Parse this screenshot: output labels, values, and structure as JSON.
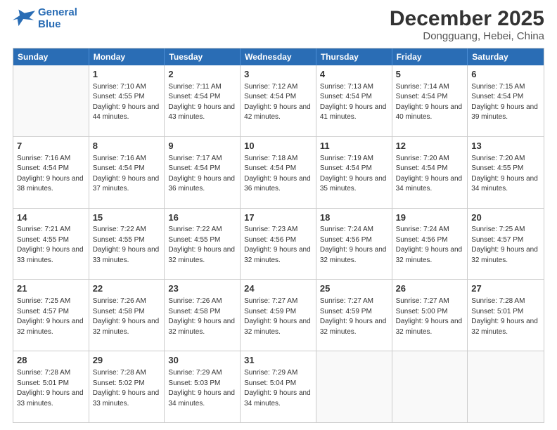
{
  "logo": {
    "line1": "General",
    "line2": "Blue"
  },
  "title": "December 2025",
  "location": "Dongguang, Hebei, China",
  "weekdays": [
    "Sunday",
    "Monday",
    "Tuesday",
    "Wednesday",
    "Thursday",
    "Friday",
    "Saturday"
  ],
  "weeks": [
    [
      {
        "day": "",
        "sunrise": "",
        "sunset": "",
        "daylight": ""
      },
      {
        "day": "1",
        "sunrise": "Sunrise: 7:10 AM",
        "sunset": "Sunset: 4:55 PM",
        "daylight": "Daylight: 9 hours and 44 minutes."
      },
      {
        "day": "2",
        "sunrise": "Sunrise: 7:11 AM",
        "sunset": "Sunset: 4:54 PM",
        "daylight": "Daylight: 9 hours and 43 minutes."
      },
      {
        "day": "3",
        "sunrise": "Sunrise: 7:12 AM",
        "sunset": "Sunset: 4:54 PM",
        "daylight": "Daylight: 9 hours and 42 minutes."
      },
      {
        "day": "4",
        "sunrise": "Sunrise: 7:13 AM",
        "sunset": "Sunset: 4:54 PM",
        "daylight": "Daylight: 9 hours and 41 minutes."
      },
      {
        "day": "5",
        "sunrise": "Sunrise: 7:14 AM",
        "sunset": "Sunset: 4:54 PM",
        "daylight": "Daylight: 9 hours and 40 minutes."
      },
      {
        "day": "6",
        "sunrise": "Sunrise: 7:15 AM",
        "sunset": "Sunset: 4:54 PM",
        "daylight": "Daylight: 9 hours and 39 minutes."
      }
    ],
    [
      {
        "day": "7",
        "sunrise": "Sunrise: 7:16 AM",
        "sunset": "Sunset: 4:54 PM",
        "daylight": "Daylight: 9 hours and 38 minutes."
      },
      {
        "day": "8",
        "sunrise": "Sunrise: 7:16 AM",
        "sunset": "Sunset: 4:54 PM",
        "daylight": "Daylight: 9 hours and 37 minutes."
      },
      {
        "day": "9",
        "sunrise": "Sunrise: 7:17 AM",
        "sunset": "Sunset: 4:54 PM",
        "daylight": "Daylight: 9 hours and 36 minutes."
      },
      {
        "day": "10",
        "sunrise": "Sunrise: 7:18 AM",
        "sunset": "Sunset: 4:54 PM",
        "daylight": "Daylight: 9 hours and 36 minutes."
      },
      {
        "day": "11",
        "sunrise": "Sunrise: 7:19 AM",
        "sunset": "Sunset: 4:54 PM",
        "daylight": "Daylight: 9 hours and 35 minutes."
      },
      {
        "day": "12",
        "sunrise": "Sunrise: 7:20 AM",
        "sunset": "Sunset: 4:54 PM",
        "daylight": "Daylight: 9 hours and 34 minutes."
      },
      {
        "day": "13",
        "sunrise": "Sunrise: 7:20 AM",
        "sunset": "Sunset: 4:55 PM",
        "daylight": "Daylight: 9 hours and 34 minutes."
      }
    ],
    [
      {
        "day": "14",
        "sunrise": "Sunrise: 7:21 AM",
        "sunset": "Sunset: 4:55 PM",
        "daylight": "Daylight: 9 hours and 33 minutes."
      },
      {
        "day": "15",
        "sunrise": "Sunrise: 7:22 AM",
        "sunset": "Sunset: 4:55 PM",
        "daylight": "Daylight: 9 hours and 33 minutes."
      },
      {
        "day": "16",
        "sunrise": "Sunrise: 7:22 AM",
        "sunset": "Sunset: 4:55 PM",
        "daylight": "Daylight: 9 hours and 32 minutes."
      },
      {
        "day": "17",
        "sunrise": "Sunrise: 7:23 AM",
        "sunset": "Sunset: 4:56 PM",
        "daylight": "Daylight: 9 hours and 32 minutes."
      },
      {
        "day": "18",
        "sunrise": "Sunrise: 7:24 AM",
        "sunset": "Sunset: 4:56 PM",
        "daylight": "Daylight: 9 hours and 32 minutes."
      },
      {
        "day": "19",
        "sunrise": "Sunrise: 7:24 AM",
        "sunset": "Sunset: 4:56 PM",
        "daylight": "Daylight: 9 hours and 32 minutes."
      },
      {
        "day": "20",
        "sunrise": "Sunrise: 7:25 AM",
        "sunset": "Sunset: 4:57 PM",
        "daylight": "Daylight: 9 hours and 32 minutes."
      }
    ],
    [
      {
        "day": "21",
        "sunrise": "Sunrise: 7:25 AM",
        "sunset": "Sunset: 4:57 PM",
        "daylight": "Daylight: 9 hours and 32 minutes."
      },
      {
        "day": "22",
        "sunrise": "Sunrise: 7:26 AM",
        "sunset": "Sunset: 4:58 PM",
        "daylight": "Daylight: 9 hours and 32 minutes."
      },
      {
        "day": "23",
        "sunrise": "Sunrise: 7:26 AM",
        "sunset": "Sunset: 4:58 PM",
        "daylight": "Daylight: 9 hours and 32 minutes."
      },
      {
        "day": "24",
        "sunrise": "Sunrise: 7:27 AM",
        "sunset": "Sunset: 4:59 PM",
        "daylight": "Daylight: 9 hours and 32 minutes."
      },
      {
        "day": "25",
        "sunrise": "Sunrise: 7:27 AM",
        "sunset": "Sunset: 4:59 PM",
        "daylight": "Daylight: 9 hours and 32 minutes."
      },
      {
        "day": "26",
        "sunrise": "Sunrise: 7:27 AM",
        "sunset": "Sunset: 5:00 PM",
        "daylight": "Daylight: 9 hours and 32 minutes."
      },
      {
        "day": "27",
        "sunrise": "Sunrise: 7:28 AM",
        "sunset": "Sunset: 5:01 PM",
        "daylight": "Daylight: 9 hours and 32 minutes."
      }
    ],
    [
      {
        "day": "28",
        "sunrise": "Sunrise: 7:28 AM",
        "sunset": "Sunset: 5:01 PM",
        "daylight": "Daylight: 9 hours and 33 minutes."
      },
      {
        "day": "29",
        "sunrise": "Sunrise: 7:28 AM",
        "sunset": "Sunset: 5:02 PM",
        "daylight": "Daylight: 9 hours and 33 minutes."
      },
      {
        "day": "30",
        "sunrise": "Sunrise: 7:29 AM",
        "sunset": "Sunset: 5:03 PM",
        "daylight": "Daylight: 9 hours and 34 minutes."
      },
      {
        "day": "31",
        "sunrise": "Sunrise: 7:29 AM",
        "sunset": "Sunset: 5:04 PM",
        "daylight": "Daylight: 9 hours and 34 minutes."
      },
      {
        "day": "",
        "sunrise": "",
        "sunset": "",
        "daylight": ""
      },
      {
        "day": "",
        "sunrise": "",
        "sunset": "",
        "daylight": ""
      },
      {
        "day": "",
        "sunrise": "",
        "sunset": "",
        "daylight": ""
      }
    ]
  ]
}
